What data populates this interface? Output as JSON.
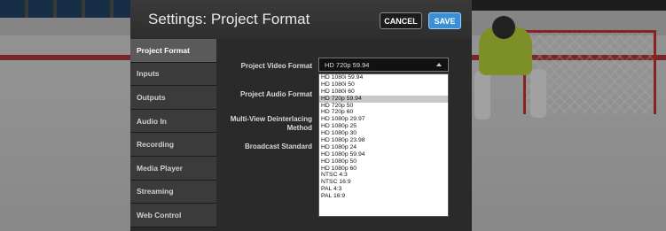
{
  "dialog": {
    "title": "Settings: Project Format",
    "cancel_label": "CANCEL",
    "save_label": "SAVE"
  },
  "sidebar": {
    "items": [
      {
        "label": "Project Format",
        "active": true
      },
      {
        "label": "Inputs"
      },
      {
        "label": "Outputs"
      },
      {
        "label": "Audio In"
      },
      {
        "label": "Recording"
      },
      {
        "label": "Media Player"
      },
      {
        "label": "Streaming"
      },
      {
        "label": "Web Control"
      }
    ]
  },
  "form": {
    "video_format_label": "Project Video Format",
    "audio_format_label": "Project Audio Format",
    "deinterlace_label_line1": "Multi-View Deinterlacing",
    "deinterlace_label_line2": "Method",
    "broadcast_label": "Broadcast Standard",
    "video_format_value": "HD 720p 59.94"
  },
  "dropdown": {
    "options": [
      "HD 1080i 59.94",
      "HD 1080i 50",
      "HD 1080i 60",
      "HD 720p 59.94",
      "HD 720p 50",
      "HD 720p 60",
      "HD 1080p 29.97",
      "HD 1080p 25",
      "HD 1080p 30",
      "HD 1080p 23.98",
      "HD 1080p 24",
      "HD 1080p 59.94",
      "HD 1080p 50",
      "HD 1080p 60",
      "NTSC 4:3",
      "NTSC 16:9",
      "PAL 4:3",
      "PAL 16:9"
    ],
    "selected": "HD 720p 59.94"
  }
}
